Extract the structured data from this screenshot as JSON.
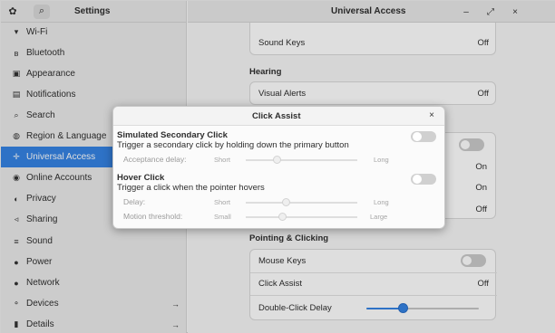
{
  "sidebar": {
    "title": "Settings",
    "items": [
      {
        "label": "Wi-Fi",
        "icon": "wifi-icon",
        "glyph": "▾"
      },
      {
        "label": "Bluetooth",
        "icon": "bluetooth-icon",
        "glyph": "ʙ"
      },
      {
        "label": "Appearance",
        "icon": "appearance-icon",
        "glyph": "▣"
      },
      {
        "label": "Notifications",
        "icon": "bell-icon",
        "glyph": "▤"
      },
      {
        "label": "Search",
        "icon": "search-icon",
        "glyph": "⌕"
      },
      {
        "label": "Region & Language",
        "icon": "globe-icon",
        "glyph": "◍"
      },
      {
        "label": "Universal Access",
        "icon": "accessibility-icon",
        "glyph": "✛"
      },
      {
        "label": "Online Accounts",
        "icon": "accounts-icon",
        "glyph": "◉"
      },
      {
        "label": "Privacy",
        "icon": "privacy-icon",
        "glyph": "◐"
      },
      {
        "label": "Sharing",
        "icon": "share-icon",
        "glyph": "◃"
      },
      {
        "label": "Sound",
        "icon": "sound-icon",
        "glyph": "≡"
      },
      {
        "label": "Power",
        "icon": "power-icon",
        "glyph": "●"
      },
      {
        "label": "Network",
        "icon": "network-icon",
        "glyph": "●"
      },
      {
        "label": "Devices",
        "icon": "devices-icon",
        "glyph": "⚬"
      },
      {
        "label": "Details",
        "icon": "details-icon",
        "glyph": "▮"
      }
    ],
    "region_arrow": "→",
    "devices_arrow": "→",
    "details_arrow": "→"
  },
  "header": {
    "title": "Universal Access",
    "minimize": "–",
    "maximize": "⤢",
    "close": "×"
  },
  "main": {
    "sound_keys_label": "Sound Keys",
    "sound_keys_value": "Off",
    "hearing_title": "Hearing",
    "visual_alerts_label": "Visual Alerts",
    "visual_alerts_value": "Off",
    "hidden_value_1": "On",
    "hidden_value_2": "On",
    "hidden_value_3": "Off",
    "pointing_title": "Pointing & Clicking",
    "mouse_keys_label": "Mouse Keys",
    "click_assist_label": "Click Assist",
    "click_assist_value": "Off",
    "double_click_label": "Double-Click Delay",
    "double_click_delay_level": 0.33
  },
  "dialog": {
    "title": "Click Assist",
    "close": "×",
    "secondary_title": "Simulated Secondary Click",
    "secondary_desc": "Trigger a secondary click by holding down the primary button",
    "acceptance_label": "Acceptance delay:",
    "acceptance_short": "Short",
    "acceptance_long": "Long",
    "hover_title": "Hover Click",
    "hover_desc": "Trigger a click when the pointer hovers",
    "delay_label": "Delay:",
    "delay_short": "Short",
    "delay_long": "Long",
    "motion_label": "Motion threshold:",
    "motion_small": "Small",
    "motion_large": "Large"
  },
  "colors": {
    "accent": "#3584e4",
    "sidebar_bg": "#ebebeb",
    "dim_overlay": "rgba(0,0,0,0.13)"
  }
}
